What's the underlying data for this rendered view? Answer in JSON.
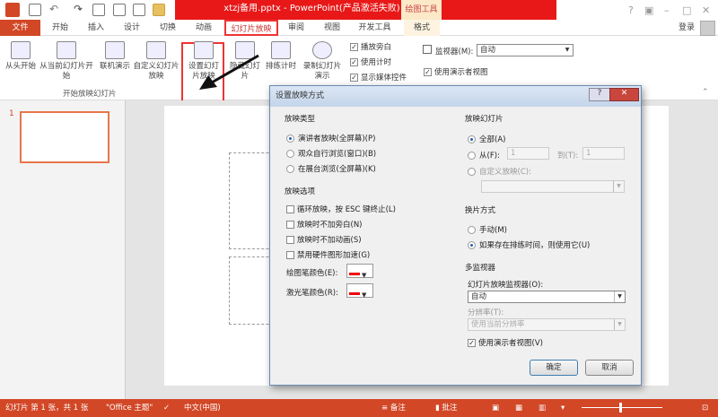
{
  "title": "xtzj备用.pptx - PowerPoint(产品激活失败)",
  "context_tab": "绘图工具",
  "login": "登录",
  "tabs": [
    "文件",
    "开始",
    "插入",
    "设计",
    "切换",
    "动画",
    "幻灯片放映",
    "审阅",
    "视图",
    "开发工具",
    "格式"
  ],
  "ribbon": {
    "from_start": "从头开始",
    "from_current": "从当前幻灯片开始",
    "online": "联机演示",
    "custom": "自定义幻灯片放映",
    "setup": "设置幻灯片放映",
    "hide": "隐藏幻灯片",
    "rehearse": "排练计时",
    "record": "录制幻灯片演示",
    "group_start": "开始放映幻灯片",
    "play_narration": "播放旁白",
    "use_timings": "使用计时",
    "show_media": "显示媒体控件",
    "monitor_label": "监视器(M):",
    "monitor_value": "自动",
    "presenter_view": "使用演示者视图"
  },
  "thumb_number": "1",
  "dialog": {
    "title": "设置放映方式",
    "show_type": {
      "heading": "放映类型",
      "options": [
        "演讲者放映(全屏幕)(P)",
        "观众自行浏览(窗口)(B)",
        "在展台浏览(全屏幕)(K)"
      ],
      "selected": 0
    },
    "show_options": {
      "heading": "放映选项",
      "items": [
        "循环放映，按 ESC 键终止(L)",
        "放映时不加旁白(N)",
        "放映时不加动画(S)",
        "禁用硬件图形加速(G)"
      ],
      "pen_color": "绘图笔颜色(E):",
      "laser_color": "激光笔颜色(R):"
    },
    "slides": {
      "heading": "放映幻灯片",
      "all": "全部(A)",
      "from": "从(F):",
      "from_value": "1",
      "to": "到(T):",
      "to_value": "1",
      "custom": "自定义放映(C):"
    },
    "advance": {
      "heading": "换片方式",
      "manual": "手动(M)",
      "timings": "如果存在排练时间，则使用它(U)"
    },
    "multi": {
      "heading": "多监视器",
      "monitor_label": "幻灯片放映监视器(O):",
      "monitor_value": "自动",
      "resolution_label": "分辨率(T):",
      "resolution_value": "使用当前分辨率",
      "presenter": "使用演示者视图(V)"
    },
    "ok": "确定",
    "cancel": "取消"
  },
  "status": {
    "slide": "幻灯片 第 1 张，共 1 张",
    "theme": "\"Office 主题\"",
    "lang": "中文(中国)",
    "notes": "备注",
    "comments": "批注"
  }
}
